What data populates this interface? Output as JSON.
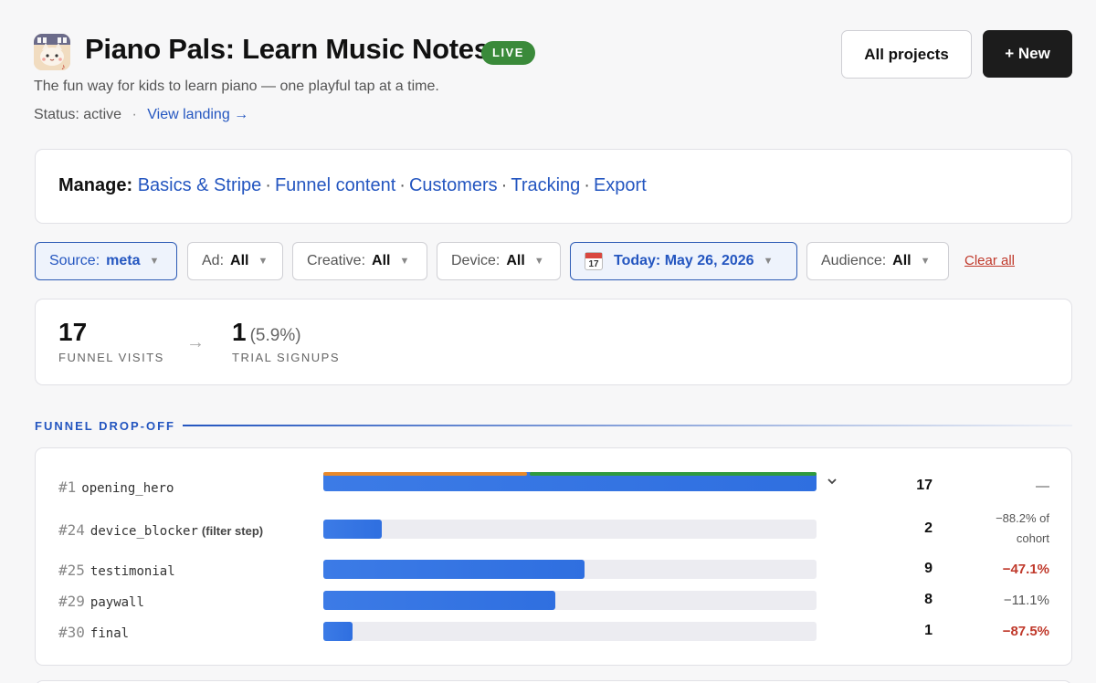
{
  "header": {
    "title": "Piano Pals: Learn Music Notes",
    "badge": "LIVE",
    "subtitle": "The fun way for kids to learn piano — one playful tap at a time.",
    "status": "Status: active",
    "status_sep": "·",
    "view_landing": "View landing →",
    "all_projects": "All projects",
    "new_button": "+ New"
  },
  "manage": {
    "label": "Manage:",
    "links": [
      "Basics & Stripe",
      "Funnel content",
      "Customers",
      "Tracking",
      "Export"
    ],
    "sep": "·"
  },
  "filters": {
    "source": {
      "label": "Source:",
      "value": "meta"
    },
    "ad": {
      "label": "Ad:",
      "value": "All"
    },
    "creative": {
      "label": "Creative:",
      "value": "All"
    },
    "device": {
      "label": "Device:",
      "value": "All"
    },
    "date": {
      "label": "Today: May 26, 2026",
      "icon_day": "17"
    },
    "audience": {
      "label": "Audience:",
      "value": "All"
    },
    "clear_all": "Clear all"
  },
  "stats": {
    "visits_value": "17",
    "visits_label": "FUNNEL VISITS",
    "arrow": "→",
    "signups_value": "1",
    "signups_pct": "(5.9%)",
    "signups_label": "TRIAL SIGNUPS"
  },
  "funnel": {
    "title": "FUNNEL DROP-OFF",
    "max_count": 17,
    "hero_split": [
      0.415,
      0.585
    ],
    "rows": [
      {
        "num": "#1",
        "step": "opening_hero",
        "note": "",
        "count": 17,
        "count_label": "17",
        "delta": "—"
      },
      {
        "num": "#24",
        "step": "device_blocker",
        "note": "(filter step)",
        "count": 2,
        "count_label": "2",
        "delta_line1": "−88.2% of",
        "delta_line2": "cohort"
      },
      {
        "num": "#25",
        "step": "testimonial",
        "note": "",
        "count": 9,
        "count_label": "9",
        "delta": "−47.1%"
      },
      {
        "num": "#29",
        "step": "paywall",
        "note": "",
        "count": 8,
        "count_label": "8",
        "delta": "−11.1%"
      },
      {
        "num": "#30",
        "step": "final",
        "note": "",
        "count": 1,
        "count_label": "1",
        "delta": "−87.5%"
      }
    ]
  },
  "colors": {
    "accent": "#2456c0",
    "live_green": "#3a8a3a",
    "bar_blue": "#3c7be6",
    "split_orange": "#e8892b",
    "split_green": "#2f9a3e",
    "negative_red": "#c0392b"
  },
  "icons": {
    "app": "cat-piano-app-icon",
    "calendar": "calendar-icon",
    "expand": "chevron-down-icon"
  }
}
